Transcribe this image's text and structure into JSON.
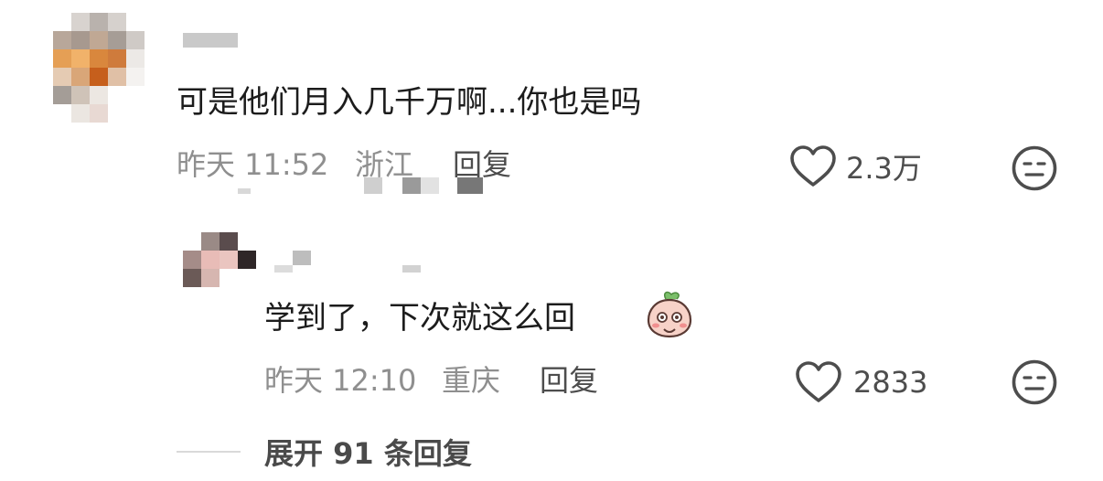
{
  "comment": {
    "text": "可是他们月入几千万啊...你也是吗",
    "time": "昨天 11:52",
    "location": "浙江",
    "reply_label": "回复",
    "like_count": "2.3万"
  },
  "reply": {
    "text": "学到了，下次就这么回",
    "emoji": "peach-blush-emoji",
    "time": "昨天 12:10",
    "location": "重庆",
    "reply_label": "回复",
    "like_count": "2833"
  },
  "expand_replies": "展开 91 条回复",
  "icons": {
    "like": "heart-outline-icon",
    "dislike": "meh-face-icon"
  },
  "colors": {
    "text_primary": "#1c1c1c",
    "text_meta": "#8f8f8f",
    "text_action": "#4d4d4d"
  }
}
